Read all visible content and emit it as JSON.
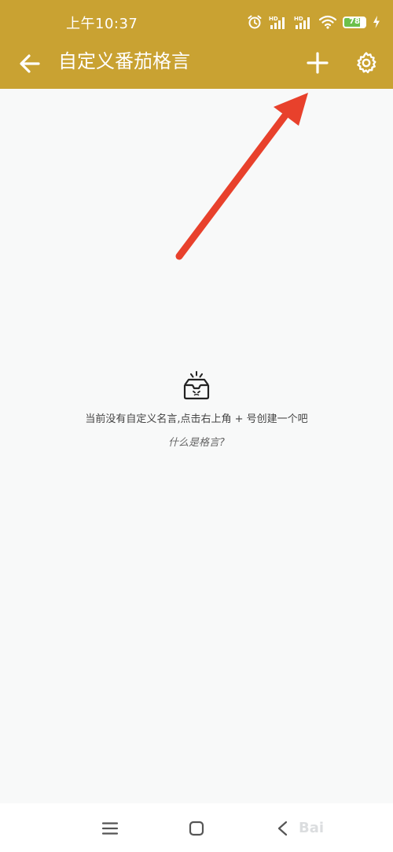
{
  "status_bar": {
    "time": "上午10:37",
    "battery_level": "78",
    "battery_percent": 78,
    "network_labels": [
      "HD",
      "HD"
    ],
    "icons": [
      "alarm-icon",
      "signal-hd-1-icon",
      "signal-hd-2-icon",
      "wifi-icon",
      "battery-icon",
      "charging-icon"
    ]
  },
  "app_bar": {
    "title": "自定义番茄格言",
    "back_icon": "arrow-left-icon",
    "add_icon": "plus-icon",
    "settings_icon": "gear-icon",
    "color": "#c9a232"
  },
  "empty_state": {
    "icon": "empty-inbox-icon",
    "message": "当前没有自定义名言,点击右上角 + 号创建一个吧",
    "link_text": "什么是格言?"
  },
  "annotation": {
    "arrow_color": "#e8412c"
  },
  "nav_bar": {
    "icons": [
      "menu-icon",
      "home-square-icon",
      "back-chevron-icon"
    ]
  },
  "watermark": {
    "text": "Bai"
  }
}
